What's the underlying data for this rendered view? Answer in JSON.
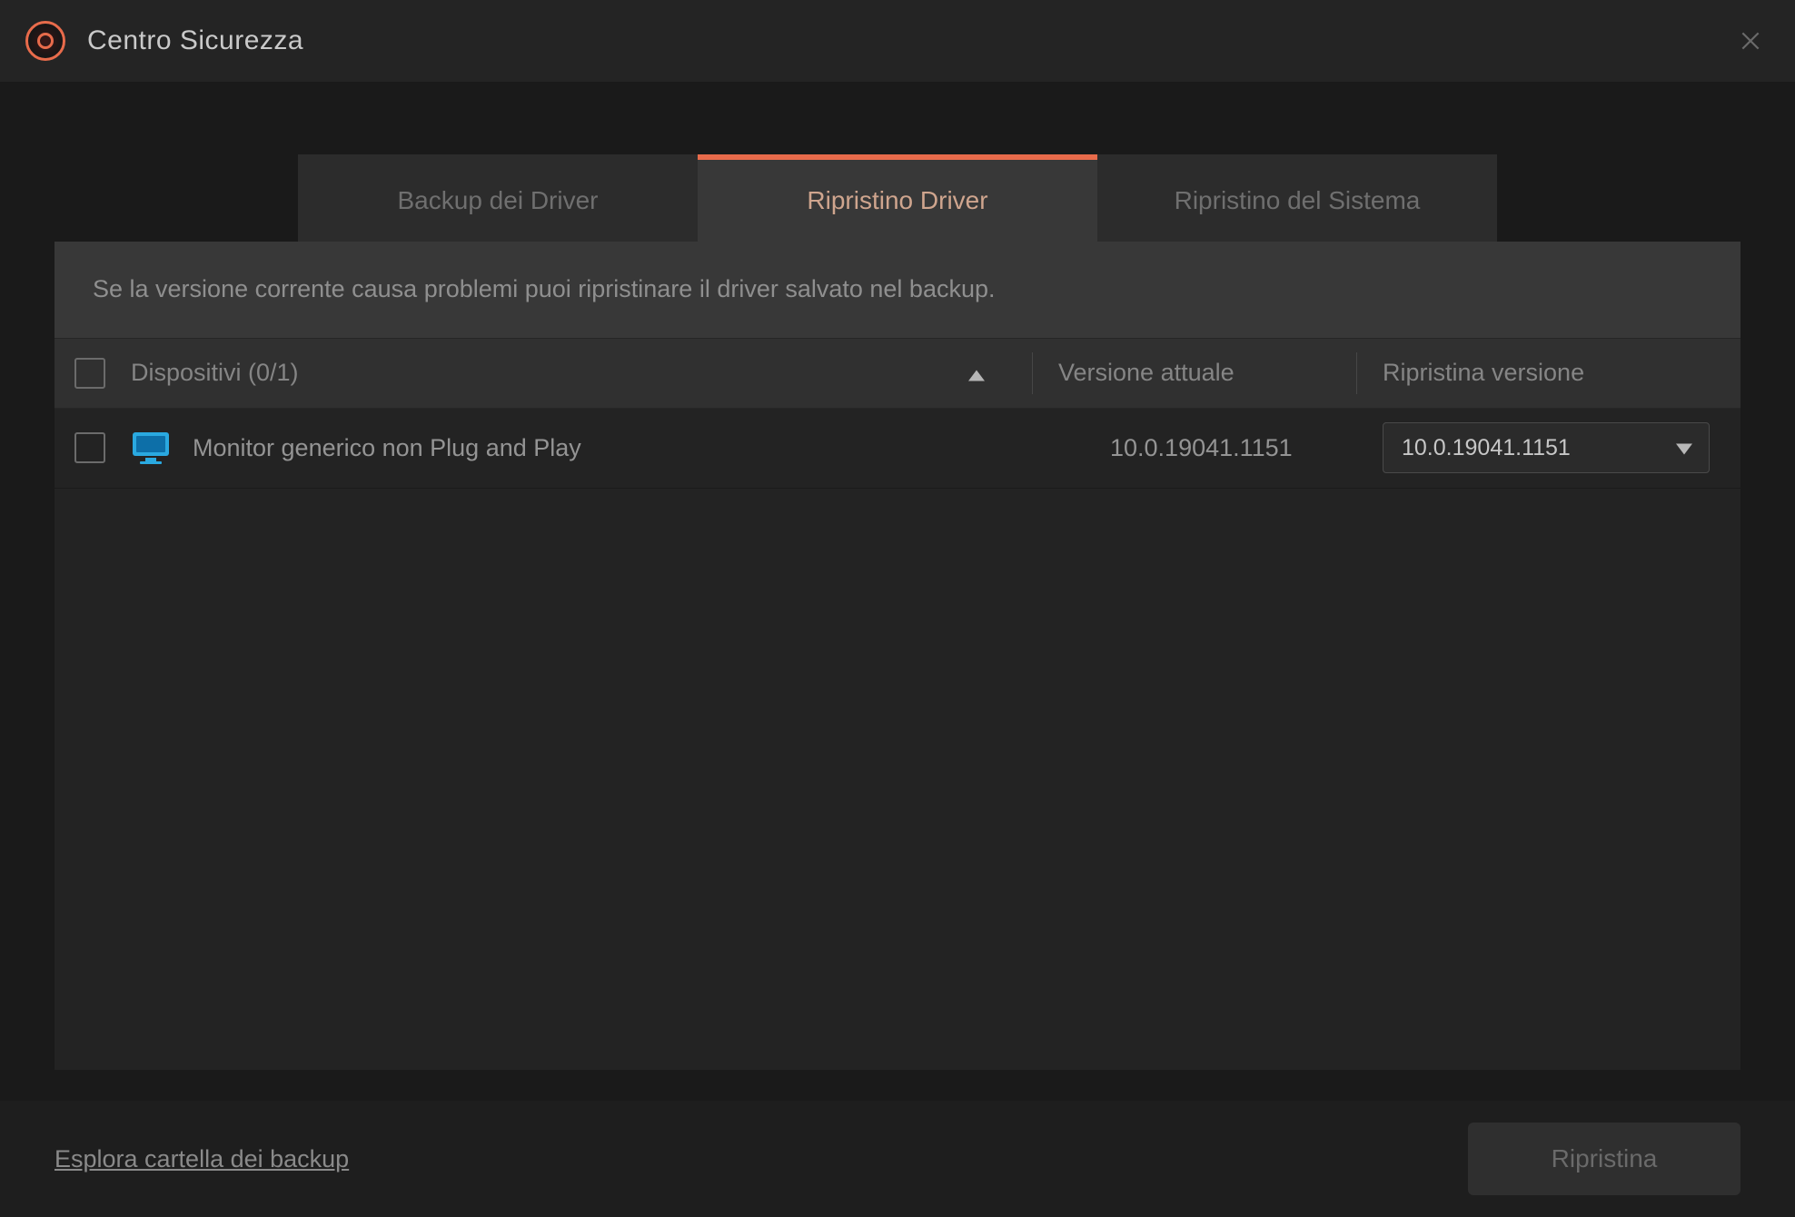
{
  "window": {
    "title": "Centro Sicurezza"
  },
  "tabs": {
    "backup": {
      "label": "Backup dei Driver"
    },
    "restore": {
      "label": "Ripristino Driver"
    },
    "system": {
      "label": "Ripristino del Sistema"
    }
  },
  "panel": {
    "description": "Se la versione corrente causa problemi puoi ripristinare il driver salvato nel backup.",
    "columns": {
      "device": "Dispositivi (0/1)",
      "current": "Versione attuale",
      "restore": "Ripristina versione"
    },
    "rows": [
      {
        "name": "Monitor generico non Plug and Play",
        "current_version": "10.0.19041.1151",
        "restore_version": "10.0.19041.1151"
      }
    ]
  },
  "footer": {
    "explore_link": "Esplora cartella dei backup",
    "action_button": "Ripristina"
  }
}
